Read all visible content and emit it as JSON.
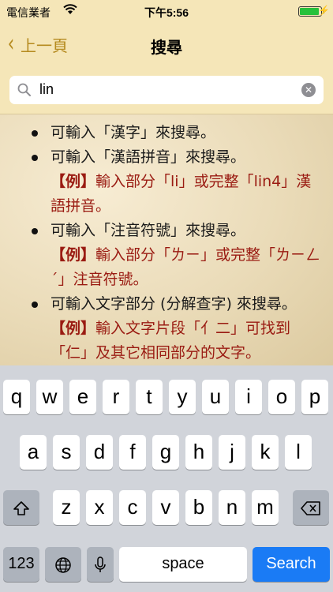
{
  "status_bar": {
    "carrier": "電信業者",
    "time": "下午5:56",
    "battery_charging": true
  },
  "nav": {
    "back_label": "上一頁",
    "title": "搜尋"
  },
  "search": {
    "value": "lin",
    "icon": "magnifier-icon",
    "clear_icon": "clear-icon"
  },
  "tips": [
    {
      "text": "可輸入「漢字」來搜尋。"
    },
    {
      "text": "可輸入「漢語拼音」來搜尋。",
      "example_tag": "【例】",
      "example_text": "輸入部分「li」或完整「lin4」漢語拼音。"
    },
    {
      "text": "可輸入「注音符號」來搜尋。",
      "example_tag": "【例】",
      "example_text": "輸入部分「ㄌㄧ」或完整「ㄌㄧㄥˊ」注音符號。"
    },
    {
      "text": "可輸入文字部分 (分解查字) 來搜尋。",
      "example_tag": "【例】",
      "example_text": "輸入文字片段「亻二」可找到「仁」及其它相同部分的文字。"
    }
  ],
  "keyboard": {
    "row1": [
      "q",
      "w",
      "e",
      "r",
      "t",
      "y",
      "u",
      "i",
      "o",
      "p"
    ],
    "row2": [
      "a",
      "s",
      "d",
      "f",
      "g",
      "h",
      "j",
      "k",
      "l"
    ],
    "row3": [
      "z",
      "x",
      "c",
      "v",
      "b",
      "n",
      "m"
    ],
    "numbers_label": "123",
    "space_label": "space",
    "search_label": "Search",
    "accent_color": "#1a7bf5"
  }
}
